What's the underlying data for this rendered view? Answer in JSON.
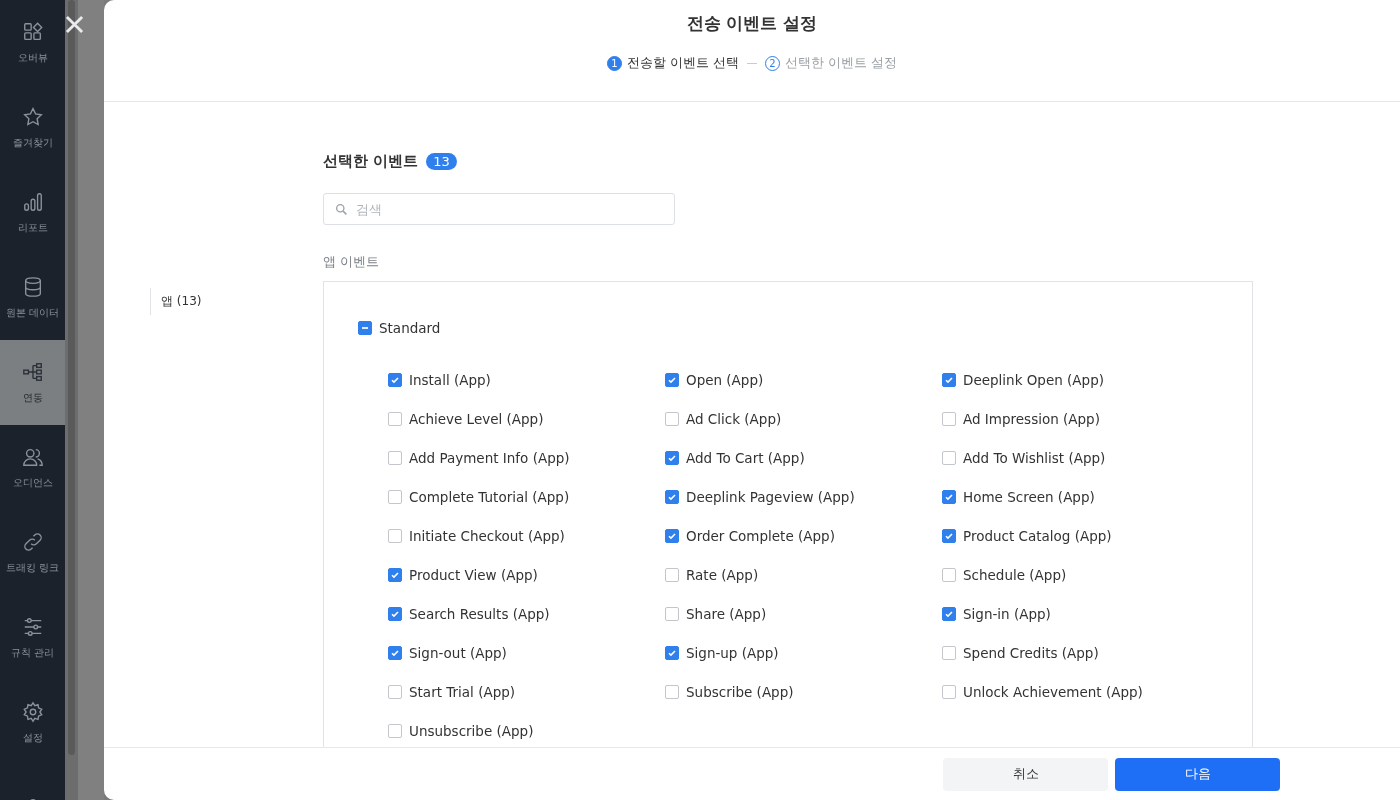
{
  "sidebar": {
    "items": [
      {
        "label": "오버뷰",
        "selected": false
      },
      {
        "label": "즐겨찾기",
        "selected": false
      },
      {
        "label": "리포트",
        "selected": false
      },
      {
        "label": "원본 데이터",
        "selected": false
      },
      {
        "label": "연동",
        "selected": true
      },
      {
        "label": "오디언스",
        "selected": false
      },
      {
        "label": "트래킹 링크",
        "selected": false
      },
      {
        "label": "규칙 관리",
        "selected": false
      },
      {
        "label": "설정",
        "selected": false
      },
      {
        "selected": false
      }
    ]
  },
  "modal": {
    "title": "전송 이벤트 설정",
    "steps": [
      {
        "number": "1",
        "label": "전송할 이벤트 선택",
        "selected": true
      },
      {
        "number": "2",
        "label": "선택한 이벤트 설정",
        "selected": false
      }
    ],
    "nav": [
      {
        "label": "앱 (13)",
        "selected": true
      }
    ],
    "heading": "선택한 이벤트",
    "count": "13",
    "search": {
      "placeholder": "검색"
    },
    "section_label": "앱 이벤트",
    "group": {
      "label": "Standard",
      "indeterminate": true,
      "events": [
        {
          "label": "Install (App)",
          "checked": true
        },
        {
          "label": "Open (App)",
          "checked": true
        },
        {
          "label": "Deeplink Open (App)",
          "checked": true
        },
        {
          "label": "Achieve Level (App)",
          "checked": false
        },
        {
          "label": "Ad Click (App)",
          "checked": false
        },
        {
          "label": "Ad Impression (App)",
          "checked": false
        },
        {
          "label": "Add Payment Info (App)",
          "checked": false
        },
        {
          "label": "Add To Cart (App)",
          "checked": true
        },
        {
          "label": "Add To Wishlist (App)",
          "checked": false
        },
        {
          "label": "Complete Tutorial (App)",
          "checked": false
        },
        {
          "label": "Deeplink Pageview (App)",
          "checked": true
        },
        {
          "label": "Home Screen (App)",
          "checked": true
        },
        {
          "label": "Initiate Checkout (App)",
          "checked": false
        },
        {
          "label": "Order Complete (App)",
          "checked": true
        },
        {
          "label": "Product Catalog (App)",
          "checked": true
        },
        {
          "label": "Product View (App)",
          "checked": true
        },
        {
          "label": "Rate (App)",
          "checked": false
        },
        {
          "label": "Schedule (App)",
          "checked": false
        },
        {
          "label": "Search Results (App)",
          "checked": true
        },
        {
          "label": "Share (App)",
          "checked": false
        },
        {
          "label": "Sign-in (App)",
          "checked": true
        },
        {
          "label": "Sign-out (App)",
          "checked": true
        },
        {
          "label": "Sign-up (App)",
          "checked": true
        },
        {
          "label": "Spend Credits (App)",
          "checked": false
        },
        {
          "label": "Start Trial (App)",
          "checked": false
        },
        {
          "label": "Subscribe (App)",
          "checked": false
        },
        {
          "label": "Unlock Achievement (App)",
          "checked": false
        },
        {
          "label": "Unsubscribe (App)",
          "checked": false
        }
      ]
    },
    "buttons": [
      {
        "kind": "secondary",
        "label": "취소"
      },
      {
        "kind": "primary",
        "label": "다음"
      }
    ]
  }
}
